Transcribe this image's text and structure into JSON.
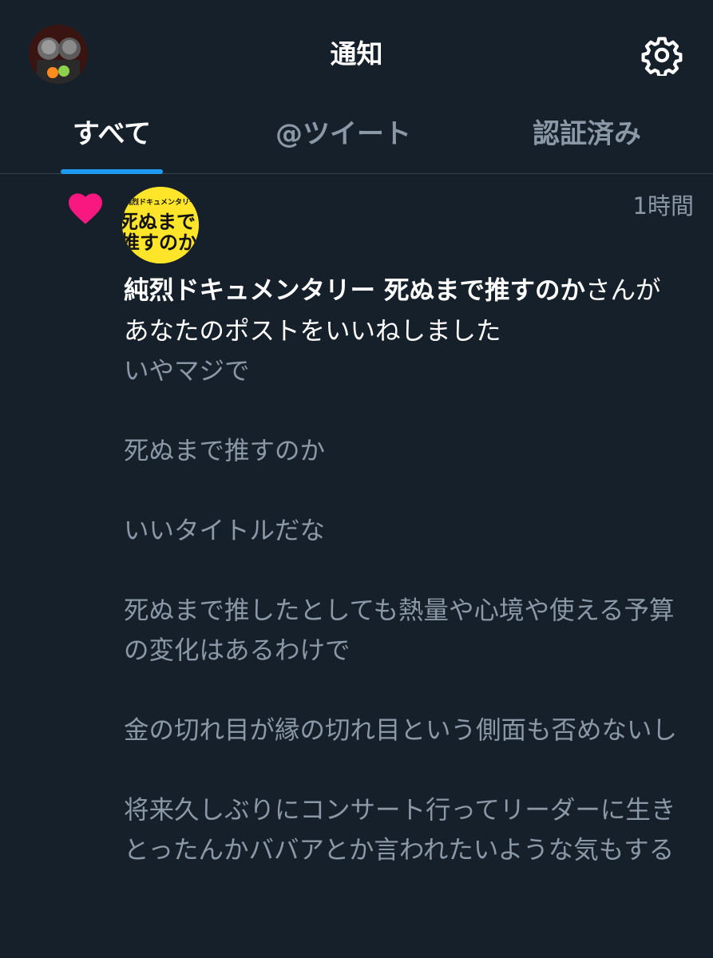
{
  "header": {
    "title": "通知"
  },
  "tabs": [
    {
      "label": "すべて",
      "active": true
    },
    {
      "label": "@ツイート",
      "active": false
    },
    {
      "label": "認証済み",
      "active": false
    }
  ],
  "notification": {
    "time": "1時間",
    "user_name": "純烈ドキュメンタリー 死ぬまで推すのか",
    "action_suffix": "さんがあなたのポストをいいねしました",
    "logo_text": {
      "top": "純烈ドキュメンタリー",
      "line1": "死ぬまで",
      "line2": "推すのか"
    },
    "tweet_paragraphs": [
      "いやマジで",
      "死ぬまで推すのか",
      "いいタイトルだな",
      "死ぬまで推したとしても熱量や心境や使える予算の変化はあるわけで",
      "金の切れ目が縁の切れ目という側面も否めないし",
      "将来久しぶりにコンサート行ってリーダーに生きとったんかババアとか言われたいような気もする"
    ]
  },
  "colors": {
    "background": "#15202b",
    "accent": "#1d9bf0",
    "heart": "#f91880",
    "muted_text": "#8b98a5",
    "divider": "#38444d",
    "logo_yellow": "#ffe52a"
  },
  "icons": {
    "avatar": "profile-avatar",
    "settings": "gear-icon",
    "like": "heart-icon"
  }
}
